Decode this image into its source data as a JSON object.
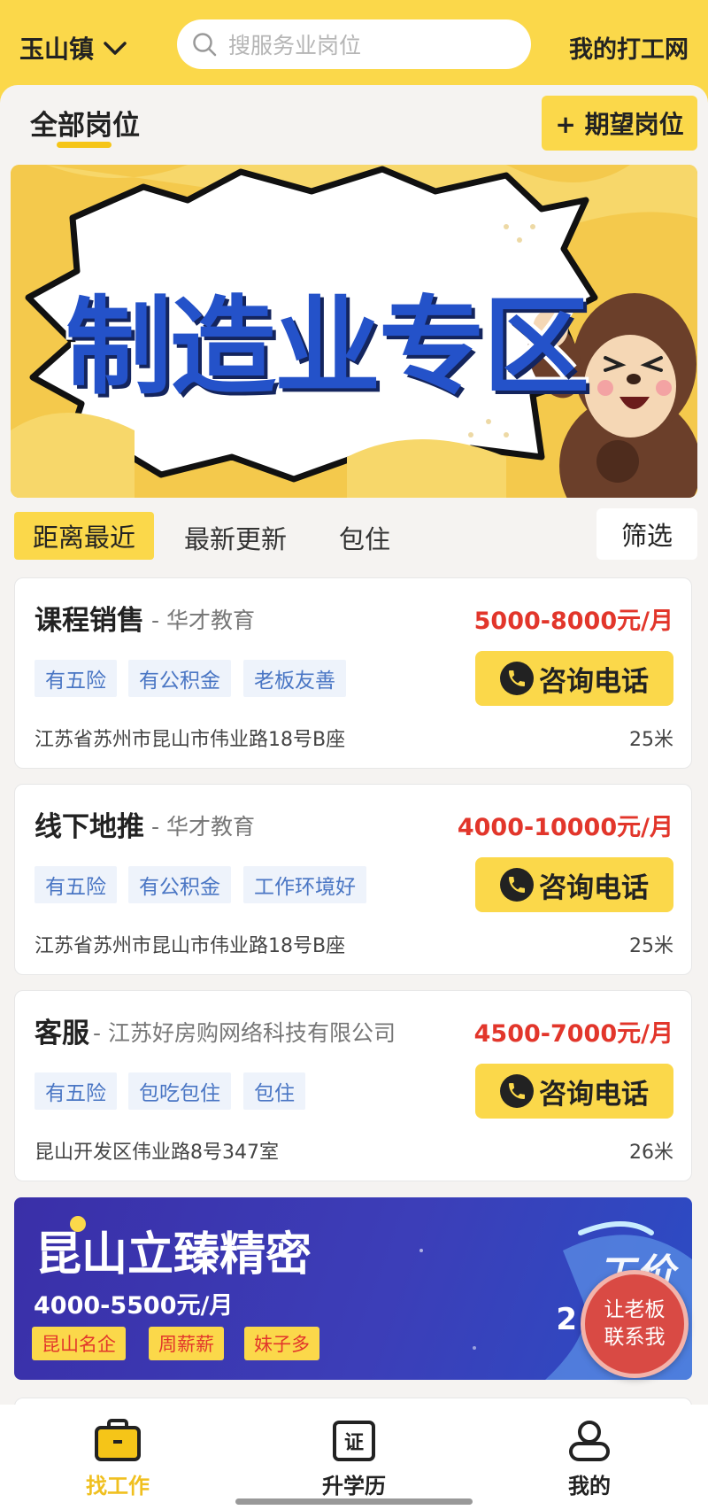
{
  "header": {
    "location": "玉山镇",
    "search_placeholder": "搜服务业岗位",
    "my_work": "我的打工网"
  },
  "tabs": {
    "all_positions": "全部岗位",
    "expect_button": "+ 期望岗位"
  },
  "banner": {
    "title": "制造业专区"
  },
  "sort": {
    "items": [
      "距离最近",
      "最新更新",
      "包住"
    ],
    "filter": "筛选"
  },
  "jobs": [
    {
      "title": "课程销售",
      "company": "- 华才教育",
      "salary": "5000-8000元/月",
      "tags": [
        "有五险",
        "有公积金",
        "老板友善"
      ],
      "address": "江苏省苏州市昆山市伟业路18号B座",
      "distance": "25米",
      "call_label": "咨询电话"
    },
    {
      "title": "线下地推",
      "company": "- 华才教育",
      "salary": "4000-10000元/月",
      "tags": [
        "有五险",
        "有公积金",
        "工作环境好"
      ],
      "address": "江苏省苏州市昆山市伟业路18号B座",
      "distance": "25米",
      "call_label": "咨询电话"
    },
    {
      "title": "客服",
      "company": "- 江苏好房购网络科技有限公司",
      "salary": "4500-7000元/月",
      "tags": [
        "有五险",
        "包吃包住",
        "包住"
      ],
      "address": "昆山开发区伟业路8号347室",
      "distance": "26米",
      "call_label": "咨询电话"
    }
  ],
  "promo": {
    "title": "昆山立臻精密",
    "salary": "4000-5500元/月",
    "tags": [
      "昆山名企",
      "周薪薪",
      "妹子多"
    ],
    "deco_text": "工价",
    "deco_num": "2"
  },
  "floating": {
    "line1": "让老板",
    "line2": "联系我"
  },
  "nav": {
    "find_job": "找工作",
    "education": "升学历",
    "cert_glyph": "证",
    "mine": "我的"
  },
  "colors": {
    "brand_yellow": "#fbd84a",
    "salary_red": "#e2362b",
    "tag_blue": "#4a76c4"
  }
}
